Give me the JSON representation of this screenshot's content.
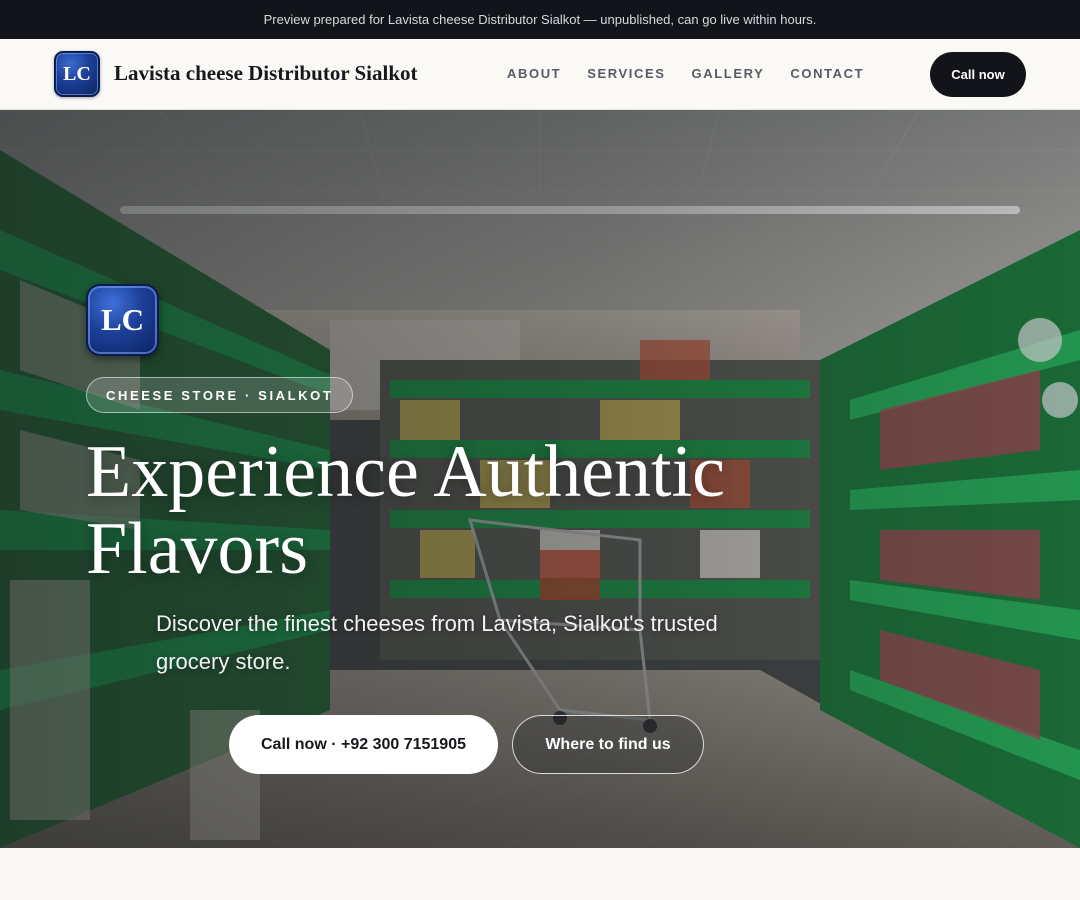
{
  "preview_banner": "Preview prepared for Lavista cheese Distributor Sialkot — unpublished, can go live within hours.",
  "brand": {
    "initials": "LC",
    "name": "Lavista cheese Distributor Sialkot"
  },
  "nav": {
    "links": [
      "ABOUT",
      "SERVICES",
      "GALLERY",
      "CONTACT"
    ],
    "cta_label": "Call now"
  },
  "hero": {
    "badge_initials": "LC",
    "tag": "CHEESE STORE · SIALKOT",
    "title": "Experience Authentic Flavors",
    "subtitle": "Discover the finest cheeses from Lavista, Sialkot's trusted grocery store.",
    "primary_button": "Call now · +92 300 7151905",
    "secondary_button": "Where to find us",
    "background_image": "supermarket aisle with green shelves and shopping cart"
  },
  "colors": {
    "dark": "#121419",
    "badge_blue": "#1b3f97",
    "shelf_green": "#1f9a4a"
  }
}
